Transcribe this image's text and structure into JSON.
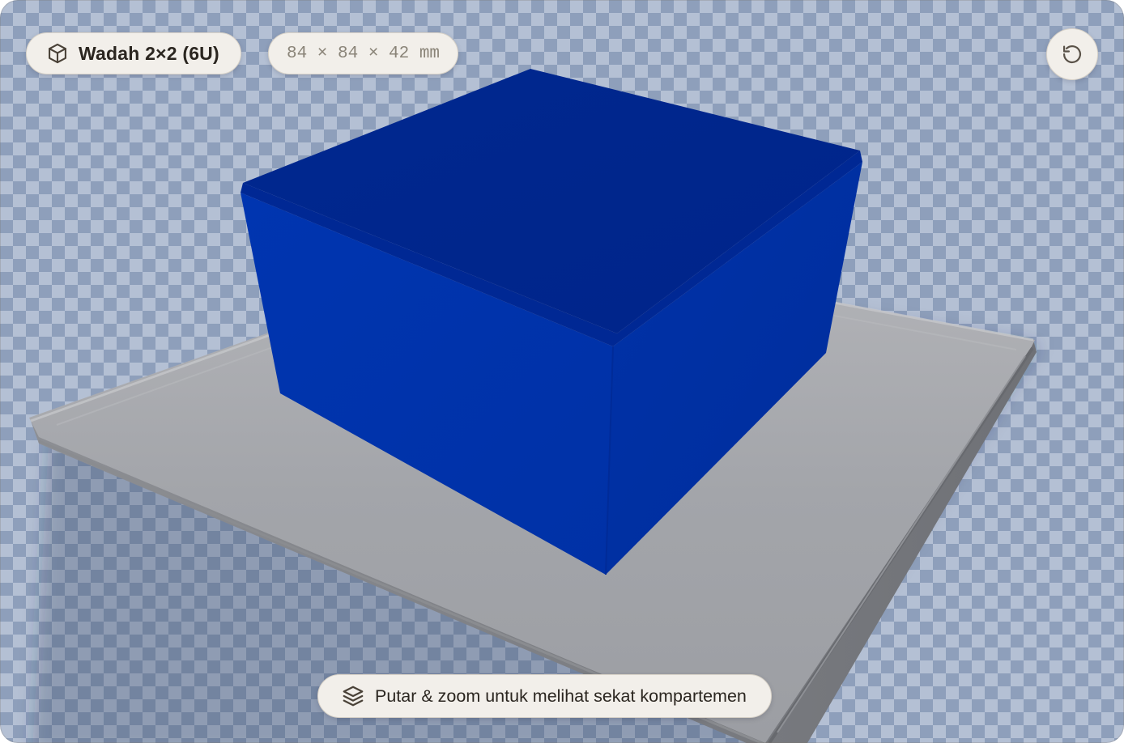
{
  "viewer": {
    "title": "Wadah 2×2 (6U)",
    "dimensions": "84 × 84 × 42 mm",
    "hint": "Putar & zoom untuk melihat sekat kompartemen",
    "reset_icon": "rotate-ccw-icon",
    "title_icon": "cube-icon",
    "hint_icon": "layers-icon"
  },
  "colors": {
    "box_front": "#0033a8",
    "box_side": "#002fa0",
    "box_top": "#00268e",
    "baseplate": "#a3a5aa",
    "checker_light": "#b4c0d4",
    "checker_dark": "#8e9fbb"
  }
}
